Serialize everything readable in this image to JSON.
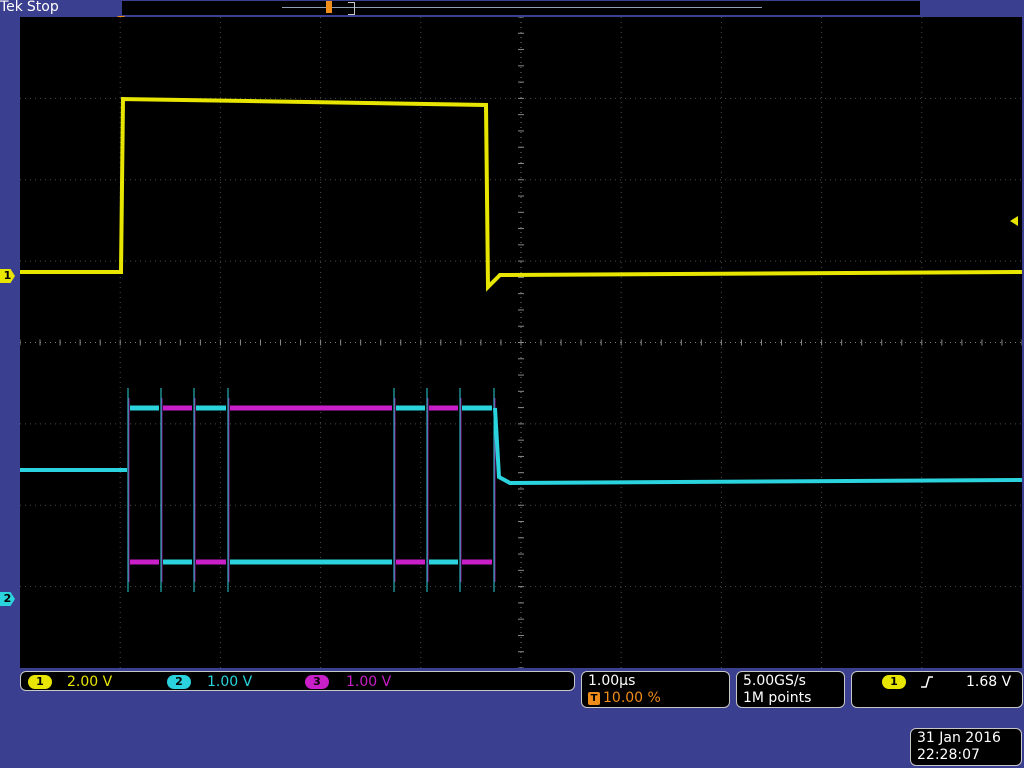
{
  "header": {
    "brand": "Tek",
    "status": "Stop"
  },
  "markers": {
    "ch1": "1",
    "ch2": "2",
    "trigger": "T"
  },
  "channels": [
    {
      "id": "1",
      "scale": "2.00 V",
      "color": "#e8e600"
    },
    {
      "id": "2",
      "scale": "1.00 V",
      "color": "#2ad3dd"
    },
    {
      "id": "3",
      "scale": "1.00 V",
      "color": "#c81fc8"
    }
  ],
  "horizontal": {
    "scale": "1.00µs",
    "trigger_tag": "T",
    "position": "10.00 %"
  },
  "sampling": {
    "rate": "5.00GS/s",
    "record_length": "1M points"
  },
  "trigger": {
    "source": "1",
    "slope_icon": "rising-edge-icon",
    "level": "1.68 V"
  },
  "datetime": {
    "date": "31 Jan  2016",
    "time": "22:28:07"
  },
  "colors": {
    "background": "#3b3f8f",
    "screen": "#000000",
    "ch1": "#e8e600",
    "ch2": "#2ad3dd",
    "ch3": "#c81fc8",
    "trigger": "#f08c1a"
  }
}
